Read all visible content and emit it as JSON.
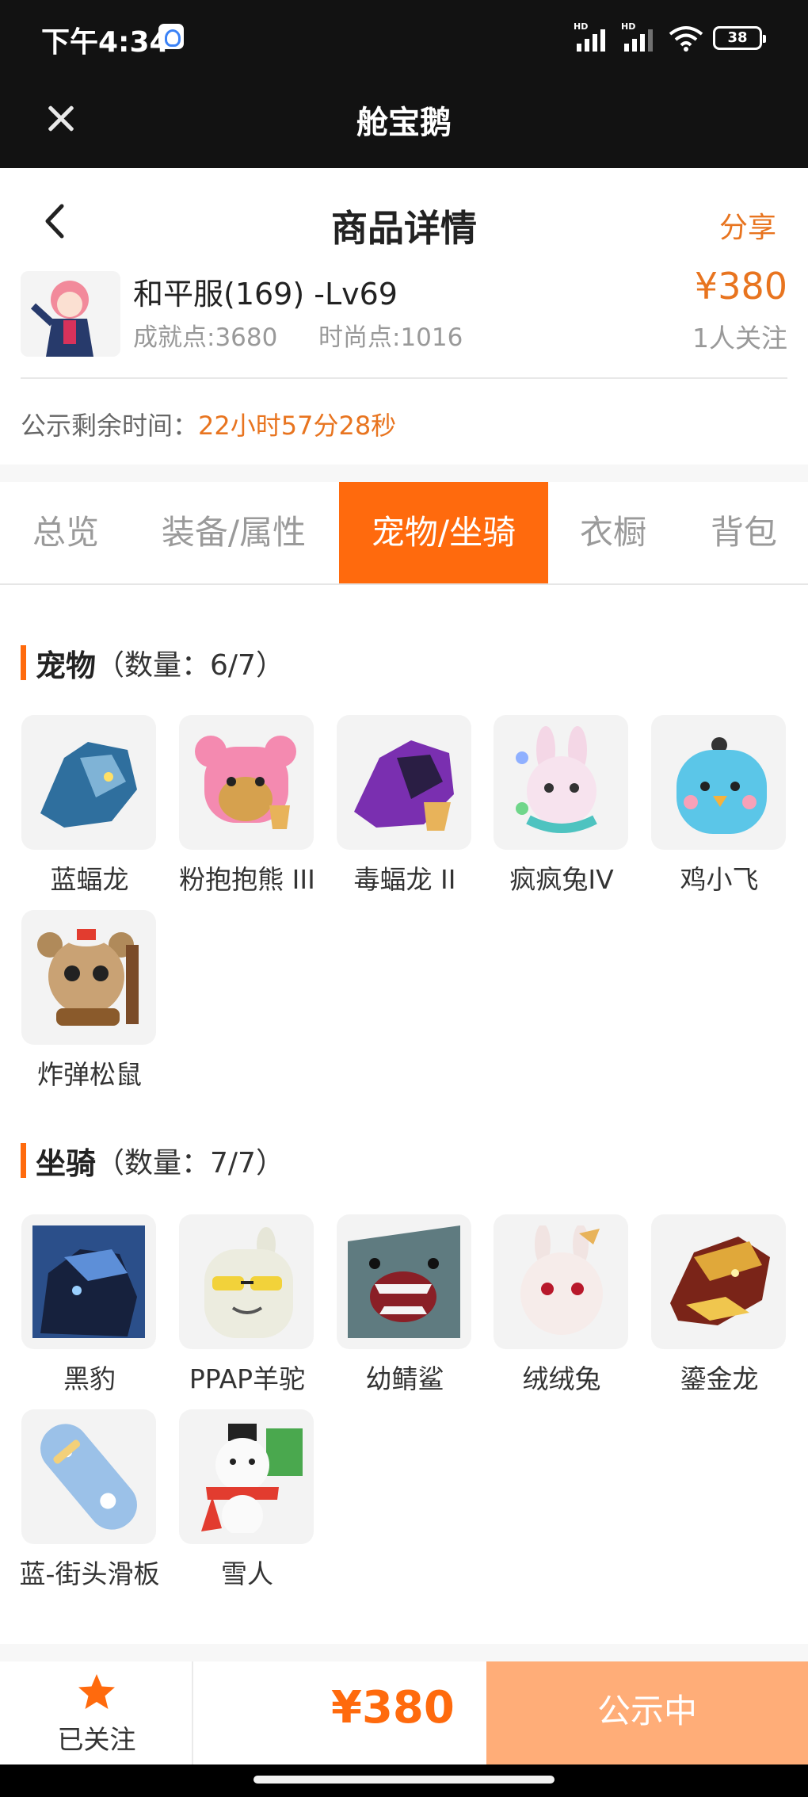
{
  "status_bar": {
    "time": "下午4:34",
    "signal1_label": "HD",
    "signal2_label": "HD",
    "battery": "38"
  },
  "app_bar": {
    "title": "舱宝鹅"
  },
  "page_header": {
    "title": "商品详情",
    "share_label": "分享"
  },
  "product": {
    "name": "和平服(169) -Lv69",
    "achievement": "成就点:3680",
    "fashion": "时尚点:1016",
    "price": "¥380",
    "followers": "1人关注",
    "countdown_label": "公示剩余时间：",
    "countdown_value": "22小时57分28秒"
  },
  "tabs": [
    {
      "label": "总览",
      "active": false
    },
    {
      "label": "装备/属性",
      "active": false
    },
    {
      "label": "宠物/坐骑",
      "active": true
    },
    {
      "label": "衣橱",
      "active": false
    },
    {
      "label": "背包",
      "active": false
    }
  ],
  "pets": {
    "title": "宠物",
    "count": "（数量：6/7）",
    "items": [
      {
        "name": "蓝蝠龙",
        "icon": "blue-bat-dragon-icon",
        "color": "#2f6f9e"
      },
      {
        "name": "粉抱抱熊 III",
        "icon": "pink-bear-icon",
        "color": "#f48ab0"
      },
      {
        "name": "毒蝠龙 II",
        "icon": "poison-bat-dragon-icon",
        "color": "#7a2fb0"
      },
      {
        "name": "疯疯兔IV",
        "icon": "crazy-rabbit-icon",
        "color": "#f4d7e6"
      },
      {
        "name": "鸡小飞",
        "icon": "chick-icon",
        "color": "#5bc6e8"
      },
      {
        "name": "炸弹松鼠",
        "icon": "bomb-squirrel-icon",
        "color": "#b08a5a"
      }
    ]
  },
  "mounts": {
    "title": "坐骑",
    "count": "（数量：7/7）",
    "items": [
      {
        "name": "黑豹",
        "icon": "black-panther-icon",
        "color": "#1c2f5a"
      },
      {
        "name": "PPAP羊驼",
        "icon": "alpaca-icon",
        "color": "#e6e6d8"
      },
      {
        "name": "幼鲭鲨",
        "icon": "baby-shark-icon",
        "color": "#5f7b80"
      },
      {
        "name": "绒绒兔",
        "icon": "fluffy-rabbit-icon",
        "color": "#f1e4e2"
      },
      {
        "name": "鎏金龙",
        "icon": "golden-dragon-icon",
        "color": "#7a2418"
      },
      {
        "name": "蓝-街头滑板",
        "icon": "skateboard-icon",
        "color": "#9bc1e8"
      },
      {
        "name": "雪人",
        "icon": "snowman-icon",
        "color": "#e23c2f"
      }
    ]
  },
  "bottom_bar": {
    "follow_label": "已关注",
    "price": "¥380",
    "status_button": "公示中"
  }
}
